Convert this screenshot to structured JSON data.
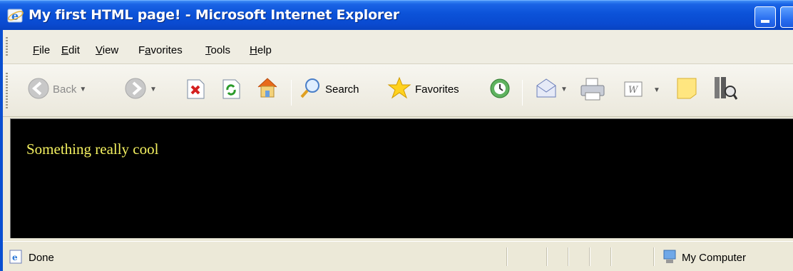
{
  "window": {
    "title": "My first HTML page! - Microsoft Internet Explorer"
  },
  "menu": [
    {
      "label": "File",
      "key": "F",
      "rest": "ile"
    },
    {
      "label": "Edit",
      "key": "E",
      "rest": "dit"
    },
    {
      "label": "View",
      "key": "V",
      "rest": "iew"
    },
    {
      "label": "Favorites",
      "key": "a",
      "pre": "F",
      "rest": "vorites"
    },
    {
      "label": "Tools",
      "key": "T",
      "rest": "ools"
    },
    {
      "label": "Help",
      "key": "H",
      "rest": "elp"
    }
  ],
  "toolbar": {
    "back_label": "Back",
    "search_label": "Search",
    "favorites_label": "Favorites"
  },
  "page": {
    "text": "Something really cool"
  },
  "status": {
    "left_text": "Done",
    "zone_text": "My Computer"
  },
  "colors": {
    "titlebar": "#0a4ad0",
    "content_bg": "#000000",
    "page_text": "#f3f060"
  }
}
